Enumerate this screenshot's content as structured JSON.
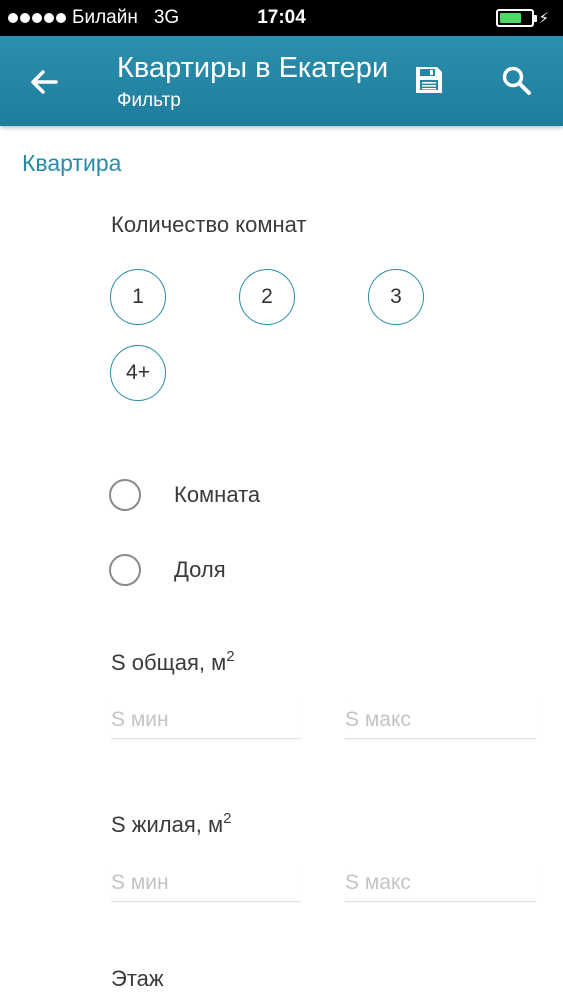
{
  "status_bar": {
    "carrier": "Билайн",
    "network": "3G",
    "time": "17:04",
    "battery_color": "#4cd964"
  },
  "appbar": {
    "title": "Квартиры в Екатеринбурге",
    "subtitle": "Фильтр",
    "color": "#2288a8",
    "icons": [
      "arrow-back-icon",
      "save-icon",
      "search-icon"
    ]
  },
  "section": {
    "title": "Квартира"
  },
  "rooms": {
    "label": "Количество комнат",
    "options": [
      "1",
      "2",
      "3",
      "4+"
    ]
  },
  "radios": [
    {
      "label": "Комната",
      "checked": false
    },
    {
      "label": "Доля",
      "checked": false
    }
  ],
  "area_total": {
    "label": "S общая, м",
    "sup": "2",
    "min_placeholder": "S мин",
    "max_placeholder": "S макс"
  },
  "area_living": {
    "label": "S жилая, м",
    "sup": "2",
    "min_placeholder": "S мин",
    "max_placeholder": "S макс"
  },
  "floor": {
    "label": "Этаж"
  }
}
